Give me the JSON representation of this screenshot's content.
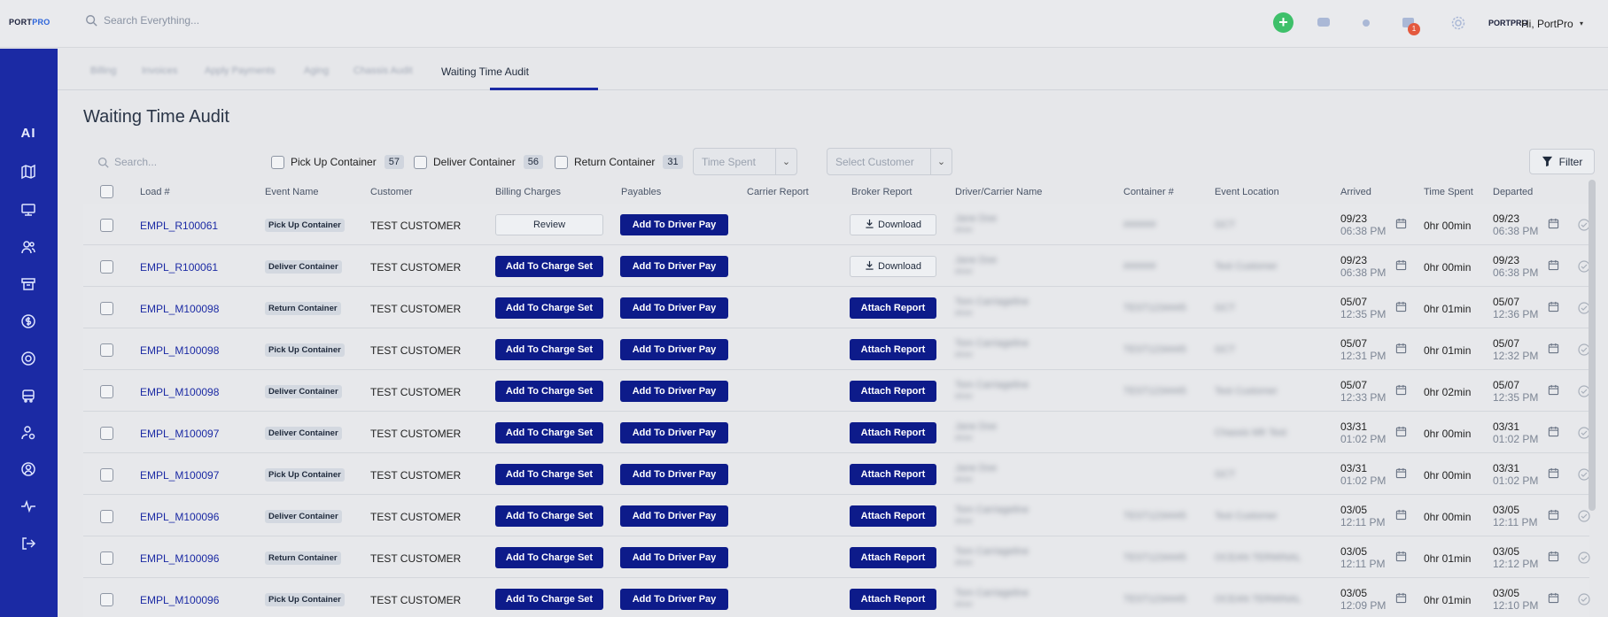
{
  "header": {
    "logo_left": "PORT",
    "logo_right": "PRO",
    "search_placeholder": "Search Everything...",
    "add_icon": "plus-icon",
    "notification_count": "1",
    "user_logo": "PORTPRO",
    "user_greeting": "Hi, PortPro",
    "caret": "▾"
  },
  "sidebar": {
    "items": [
      {
        "icon": "ai-icon",
        "label": "AI"
      },
      {
        "icon": "map-icon"
      },
      {
        "icon": "monitor-icon"
      },
      {
        "icon": "users-icon"
      },
      {
        "icon": "store-icon"
      },
      {
        "icon": "dollar-icon"
      },
      {
        "icon": "globe-icon"
      },
      {
        "icon": "truck-icon"
      },
      {
        "icon": "user-settings-icon"
      },
      {
        "icon": "profile-icon"
      },
      {
        "icon": "activity-icon"
      },
      {
        "icon": "logout-icon"
      }
    ]
  },
  "tabs": [
    {
      "label": "Billing",
      "active": false
    },
    {
      "label": "Invoices",
      "active": false
    },
    {
      "label": "Apply Payments",
      "active": false
    },
    {
      "label": "Aging",
      "active": false
    },
    {
      "label": "Chassis Audit",
      "active": false
    },
    {
      "label": "Waiting Time Audit",
      "active": true
    }
  ],
  "page_title": "Waiting Time Audit",
  "filters": {
    "search_placeholder": "Search...",
    "checkboxes": [
      {
        "label": "Pick Up Container",
        "count": "57"
      },
      {
        "label": "Deliver Container",
        "count": "56"
      },
      {
        "label": "Return Container",
        "count": "31"
      }
    ],
    "time_spent_placeholder": "Time Spent",
    "customer_placeholder": "Select Customer",
    "filter_label": "Filter"
  },
  "table": {
    "columns": [
      "Load #",
      "Event Name",
      "Customer",
      "Billing Charges",
      "Payables",
      "Carrier Report",
      "Broker Report",
      "Driver/Carrier Name",
      "Container #",
      "Event Location",
      "Arrived",
      "Time Spent",
      "Departed"
    ],
    "rows": [
      {
        "load": "EMPL_R100061",
        "event": "Pick Up Container",
        "customer": "TEST CUSTOMER",
        "billing": "Review",
        "payables": "Add To Driver Pay",
        "broker": "Download",
        "driver": "Jane Doe",
        "driver_sub": "driver",
        "container": "######",
        "location": "GCT",
        "arr_date": "09/23",
        "arr_time": "06:38 PM",
        "spent": "0hr 00min",
        "dep_date": "09/23",
        "dep_time": "06:38 PM"
      },
      {
        "load": "EMPL_R100061",
        "event": "Deliver Container",
        "customer": "TEST CUSTOMER",
        "billing": "Add To Charge Set",
        "payables": "Add To Driver Pay",
        "broker": "Download",
        "driver": "Jane Doe",
        "driver_sub": "driver",
        "container": "######",
        "location": "Test Customer",
        "arr_date": "09/23",
        "arr_time": "06:38 PM",
        "spent": "0hr 00min",
        "dep_date": "09/23",
        "dep_time": "06:38 PM"
      },
      {
        "load": "EMPL_M100098",
        "event": "Return Container",
        "customer": "TEST CUSTOMER",
        "billing": "Add To Charge Set",
        "payables": "Add To Driver Pay",
        "broker": "Attach Report",
        "driver": "Tom Carriageline",
        "driver_sub": "driver",
        "container": "TEST1234445",
        "location": "GCT",
        "arr_date": "05/07",
        "arr_time": "12:35 PM",
        "spent": "0hr 01min",
        "dep_date": "05/07",
        "dep_time": "12:36 PM"
      },
      {
        "load": "EMPL_M100098",
        "event": "Pick Up Container",
        "customer": "TEST CUSTOMER",
        "billing": "Add To Charge Set",
        "payables": "Add To Driver Pay",
        "broker": "Attach Report",
        "driver": "Tom Carriageline",
        "driver_sub": "driver",
        "container": "TEST1234445",
        "location": "GCT",
        "arr_date": "05/07",
        "arr_time": "12:31 PM",
        "spent": "0hr 01min",
        "dep_date": "05/07",
        "dep_time": "12:32 PM"
      },
      {
        "load": "EMPL_M100098",
        "event": "Deliver Container",
        "customer": "TEST CUSTOMER",
        "billing": "Add To Charge Set",
        "payables": "Add To Driver Pay",
        "broker": "Attach Report",
        "driver": "Tom Carriageline",
        "driver_sub": "driver",
        "container": "TEST1234445",
        "location": "Test Customer",
        "arr_date": "05/07",
        "arr_time": "12:33 PM",
        "spent": "0hr 02min",
        "dep_date": "05/07",
        "dep_time": "12:35 PM"
      },
      {
        "load": "EMPL_M100097",
        "event": "Deliver Container",
        "customer": "TEST CUSTOMER",
        "billing": "Add To Charge Set",
        "payables": "Add To Driver Pay",
        "broker": "Attach Report",
        "driver": "Jane Doe",
        "driver_sub": "driver",
        "container": "",
        "location": "Chassis Mfr Test",
        "arr_date": "03/31",
        "arr_time": "01:02 PM",
        "spent": "0hr 00min",
        "dep_date": "03/31",
        "dep_time": "01:02 PM"
      },
      {
        "load": "EMPL_M100097",
        "event": "Pick Up Container",
        "customer": "TEST CUSTOMER",
        "billing": "Add To Charge Set",
        "payables": "Add To Driver Pay",
        "broker": "Attach Report",
        "driver": "Jane Doe",
        "driver_sub": "driver",
        "container": "",
        "location": "GCT",
        "arr_date": "03/31",
        "arr_time": "01:02 PM",
        "spent": "0hr 00min",
        "dep_date": "03/31",
        "dep_time": "01:02 PM"
      },
      {
        "load": "EMPL_M100096",
        "event": "Deliver Container",
        "customer": "TEST CUSTOMER",
        "billing": "Add To Charge Set",
        "payables": "Add To Driver Pay",
        "broker": "Attach Report",
        "driver": "Tom Carriageline",
        "driver_sub": "driver",
        "container": "TEST1234445",
        "location": "Test Customer",
        "arr_date": "03/05",
        "arr_time": "12:11 PM",
        "spent": "0hr 00min",
        "dep_date": "03/05",
        "dep_time": "12:11 PM"
      },
      {
        "load": "EMPL_M100096",
        "event": "Return Container",
        "customer": "TEST CUSTOMER",
        "billing": "Add To Charge Set",
        "payables": "Add To Driver Pay",
        "broker": "Attach Report",
        "driver": "Tom Carriageline",
        "driver_sub": "driver",
        "container": "TEST1234445",
        "location": "OCEAN TERMINAL",
        "arr_date": "03/05",
        "arr_time": "12:11 PM",
        "spent": "0hr 01min",
        "dep_date": "03/05",
        "dep_time": "12:12 PM"
      },
      {
        "load": "EMPL_M100096",
        "event": "Pick Up Container",
        "customer": "TEST CUSTOMER",
        "billing": "Add To Charge Set",
        "payables": "Add To Driver Pay",
        "broker": "Attach Report",
        "driver": "Tom Carriageline",
        "driver_sub": "driver",
        "container": "TEST1234445",
        "location": "OCEAN TERMINAL",
        "arr_date": "03/05",
        "arr_time": "12:09 PM",
        "spent": "0hr 01min",
        "dep_date": "03/05",
        "dep_time": "12:10 PM"
      }
    ]
  },
  "colors": {
    "sidebar": "#1b2aa4",
    "primary_button": "#0d1b8a",
    "add_button": "#3ec06a",
    "badge": "#e4593e"
  }
}
